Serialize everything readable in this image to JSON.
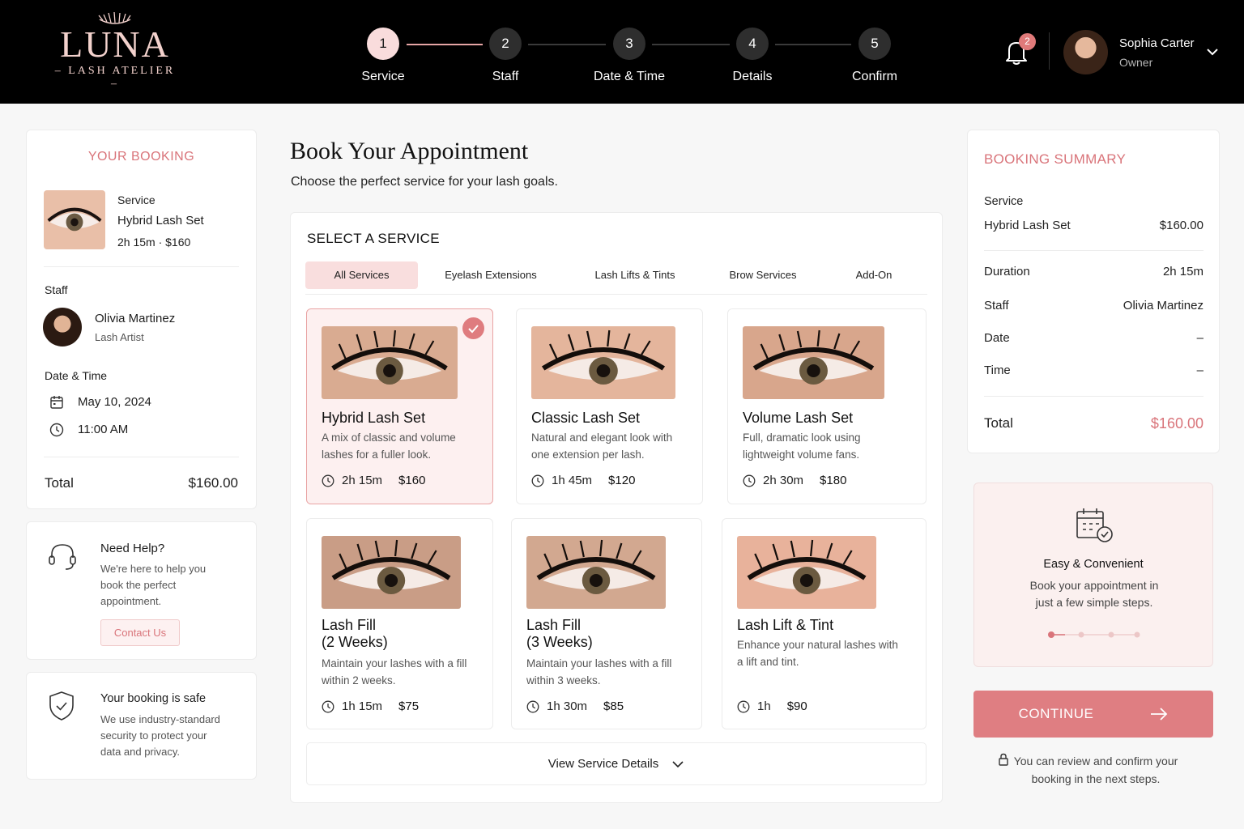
{
  "brand": {
    "name": "LUNA",
    "tagline": "LASH ATELIER"
  },
  "steps": [
    {
      "num": "1",
      "label": "Service"
    },
    {
      "num": "2",
      "label": "Staff"
    },
    {
      "num": "3",
      "label": "Date & Time"
    },
    {
      "num": "4",
      "label": "Details"
    },
    {
      "num": "5",
      "label": "Confirm"
    }
  ],
  "notifications": {
    "count": "2"
  },
  "user": {
    "name": "Sophia Carter",
    "role": "Owner"
  },
  "booking": {
    "title": "YOUR BOOKING",
    "service_label": "Service",
    "service_name": "Hybrid Lash Set",
    "service_meta": "2h 15m  ·  $160",
    "staff_label": "Staff",
    "staff_name": "Olivia Martinez",
    "staff_role": "Lash Artist",
    "datetime_label": "Date & Time",
    "date": "May 10, 2024",
    "time": "11:00 AM",
    "total_label": "Total",
    "total_value": "$160.00"
  },
  "help": {
    "title": "Need Help?",
    "text": "We're here to help you book the perfect appointment.",
    "button": "Contact Us"
  },
  "safe": {
    "title": "Your booking is safe",
    "text": "We use industry-standard security to protect your data and privacy."
  },
  "main": {
    "title": "Book Your Appointment",
    "subtitle": "Choose the perfect service for your lash goals.",
    "section_title": "SELECT A SERVICE",
    "tabs": [
      "All Services",
      "Eyelash Extensions",
      "Lash Lifts & Tints",
      "Brow Services",
      "Add-On"
    ],
    "services": [
      {
        "name": "Hybrid Lash Set",
        "desc": "A mix of classic and volume lashes for a fuller look.",
        "duration": "2h 15m",
        "price": "$160"
      },
      {
        "name": "Classic Lash Set",
        "desc": "Natural and elegant look with one extension per lash.",
        "duration": "1h 45m",
        "price": "$120"
      },
      {
        "name": "Volume Lash Set",
        "desc": "Full, dramatic look using lightweight volume fans.",
        "duration": "2h 30m",
        "price": "$180"
      },
      {
        "name": "Lash Fill\n(2 Weeks)",
        "desc": "Maintain your lashes with a fill within 2 weeks.",
        "duration": "1h 15m",
        "price": "$75"
      },
      {
        "name": "Lash Fill\n(3 Weeks)",
        "desc": "Maintain your lashes with a fill within 3 weeks.",
        "duration": "1h 30m",
        "price": "$85"
      },
      {
        "name": "Lash Lift & Tint",
        "desc": "Enhance your natural lashes with a lift and tint.",
        "duration": "1h",
        "price": "$90"
      }
    ],
    "view_details": "View Service Details"
  },
  "summary": {
    "title": "BOOKING SUMMARY",
    "service_label": "Service",
    "service_name": "Hybrid Lash Set",
    "service_price": "$160.00",
    "duration_label": "Duration",
    "duration_value": "2h 15m",
    "staff_label": "Staff",
    "staff_value": "Olivia Martinez",
    "date_label": "Date",
    "date_value": "–",
    "time_label": "Time",
    "time_value": "–",
    "total_label": "Total",
    "total_value": "$160.00"
  },
  "promo": {
    "title": "Easy & Convenient",
    "text": "Book your appointment in just a few simple steps."
  },
  "continue": {
    "label": "CONTINUE"
  },
  "note": "You can review and confirm your booking in the next steps.",
  "colors": {
    "accent": "#df7e82",
    "accent_light": "#f9dede",
    "header_bg": "#000000"
  }
}
